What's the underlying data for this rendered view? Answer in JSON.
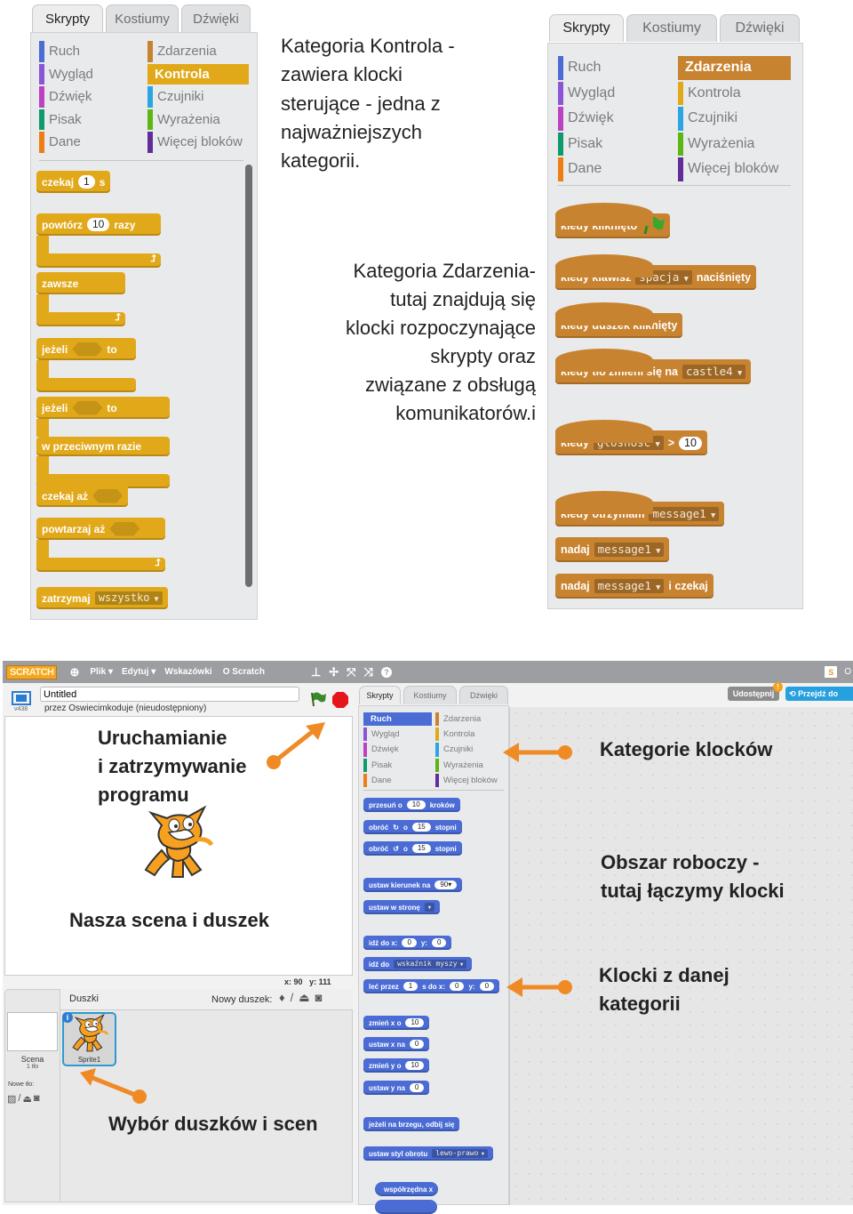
{
  "colors": {
    "motion": "#4a6cd4",
    "control": "#e1a91a",
    "events": "#c88330",
    "arrow": "#f08a24",
    "menubar": "#9c9ea2"
  },
  "tabs": [
    "Skrypty",
    "Kostiumy",
    "Dźwięki"
  ],
  "categories": [
    {
      "label": "Ruch",
      "color": "#4a6cd4"
    },
    {
      "label": "Zdarzenia",
      "color": "#c88330"
    },
    {
      "label": "Wygląd",
      "color": "#8a55d7"
    },
    {
      "label": "Kontrola",
      "color": "#e1a91a"
    },
    {
      "label": "Dźwięk",
      "color": "#bb42c3"
    },
    {
      "label": "Czujniki",
      "color": "#2ca5e2"
    },
    {
      "label": "Pisak",
      "color": "#0e9a6c"
    },
    {
      "label": "Wyrażenia",
      "color": "#5cb712"
    },
    {
      "label": "Dane",
      "color": "#ee7d16"
    },
    {
      "label": "Więcej bloków",
      "color": "#632d99"
    }
  ],
  "panel1": {
    "selected_category": "Kontrola",
    "blocks": [
      {
        "parts": [
          "czekaj",
          {
            "n": "1"
          },
          "s"
        ]
      },
      {
        "parts": [
          "powtórz",
          {
            "n": "10"
          },
          "razy"
        ]
      },
      {
        "parts": [
          "zawsze"
        ]
      },
      {
        "parts": [
          "jeżeli",
          {
            "h": 1
          },
          "to"
        ]
      },
      {
        "parts": [
          "jeżeli",
          {
            "h": 1
          },
          "to"
        ],
        "else": [
          "w przeciwnym razie"
        ]
      },
      {
        "parts": [
          "czekaj  aż",
          {
            "h": 1
          }
        ]
      },
      {
        "parts": [
          "powtarzaj  aż",
          {
            "h": 1
          }
        ]
      },
      {
        "parts": [
          "zatrzymaj",
          {
            "d": "wszystko"
          }
        ]
      }
    ]
  },
  "note1": [
    "Kategoria Kontrola -",
    "zawiera klocki",
    "sterujące - jedna z",
    "najważniejszych",
    "kategorii."
  ],
  "panel2": {
    "selected_category": "Zdarzenia",
    "blocks": [
      {
        "parts": [
          "kiedy kliknięto",
          {
            "flag": 1
          }
        ]
      },
      {
        "parts": [
          "kiedy klawisz",
          {
            "d": "spacja"
          },
          "naciśnięty"
        ]
      },
      {
        "parts": [
          "kiedy duszek kliknięty"
        ]
      },
      {
        "parts": [
          "kiedy tło zmieni się na",
          {
            "d": "castle4"
          }
        ]
      },
      {
        "parts": [
          "kiedy",
          {
            "d": "głośność"
          },
          ">",
          {
            "n": "10"
          }
        ]
      },
      {
        "parts": [
          "kiedy otrzymam",
          {
            "d": "message1"
          }
        ]
      },
      {
        "parts": [
          "nadaj",
          {
            "d": "message1"
          }
        ]
      },
      {
        "parts": [
          "nadaj",
          {
            "d": "message1"
          },
          "i czekaj"
        ]
      }
    ]
  },
  "note2": [
    "Kategoria Zdarzenia-",
    "tutaj znajdują się",
    "klocki rozpoczynające",
    "skrypty oraz",
    "związane z obsługą",
    "komunikatorów.i"
  ],
  "editor": {
    "logo": "SCRATCH",
    "menu": [
      "Plik ▾",
      "Edytuj ▾",
      "Wskazówki",
      "O Scratch"
    ],
    "project_title": "Untitled",
    "version": "v438",
    "author": "przez Oswiecimkoduje (nieudostępniony)",
    "share_button": "Udostępnij",
    "see_project_button": "Przejdź do",
    "user_initial": "O",
    "selected_category": "Ruch",
    "coords": {
      "x_label": "x:",
      "x": "90",
      "y_label": "y:",
      "y": "111"
    },
    "sprites_label": "Duszki",
    "new_sprite_label": "Nowy duszek:",
    "stage_label": "Scena",
    "stage_backdrops": "1 tło",
    "new_backdrop_label": "Nowe tło:",
    "sprite_name": "Sprite1",
    "blocks": [
      {
        "parts": [
          "przesuń o",
          {
            "n": "10"
          },
          "kroków"
        ]
      },
      {
        "parts": [
          "obróć",
          {
            "i": "↻"
          },
          "o",
          {
            "n": "15"
          },
          "stopni"
        ]
      },
      {
        "parts": [
          "obróć",
          {
            "i": "↺"
          },
          "o",
          {
            "n": "15"
          },
          "stopni"
        ]
      },
      {
        "parts": [
          "ustaw kierunek na",
          {
            "n": "90▾"
          }
        ]
      },
      {
        "parts": [
          "ustaw w stronę",
          {
            "d": ""
          }
        ]
      },
      {
        "parts": [
          "idź do x:",
          {
            "n": "0"
          },
          "y:",
          {
            "n": "0"
          }
        ]
      },
      {
        "parts": [
          "idź do",
          {
            "d": "wskaźnik myszy"
          }
        ]
      },
      {
        "parts": [
          "leć przez",
          {
            "n": "1"
          },
          "s do x:",
          {
            "n": "0"
          },
          "y:",
          {
            "n": "0"
          }
        ]
      },
      {
        "parts": [
          "zmień x o",
          {
            "n": "10"
          }
        ]
      },
      {
        "parts": [
          "ustaw x na",
          {
            "n": "0"
          }
        ]
      },
      {
        "parts": [
          "zmień y o",
          {
            "n": "10"
          }
        ]
      },
      {
        "parts": [
          "ustaw y na",
          {
            "n": "0"
          }
        ]
      },
      {
        "parts": [
          "jeżeli na brzegu, odbij się"
        ]
      },
      {
        "parts": [
          "ustaw styl obrotu",
          {
            "d": "lewo-prawo"
          }
        ]
      },
      {
        "parts": [
          "współrzędna x"
        ]
      },
      {
        "parts": [
          ""
        ]
      }
    ],
    "annotations": {
      "run_stop": [
        "Uruchamianie",
        "i zatrzymywanie",
        "programu"
      ],
      "stage_sprite": "Nasza scena i duszek",
      "categories": "Kategorie klocków",
      "workspace": [
        "Obszar roboczy -",
        "tutaj łączymy klocki"
      ],
      "blocks": [
        "Klocki z danej",
        "kategorii"
      ],
      "sprite_select": "Wybór duszków i scen"
    }
  }
}
